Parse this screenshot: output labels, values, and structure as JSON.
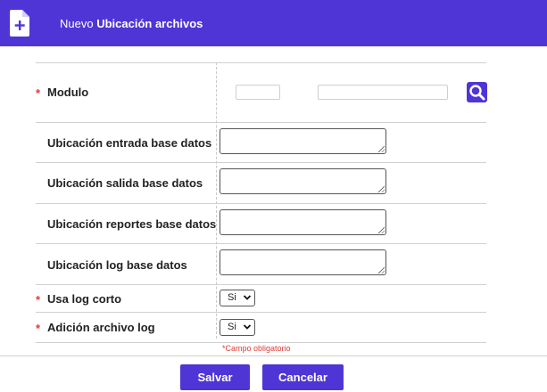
{
  "header": {
    "prefix": "Nuevo",
    "title": "Ubicación archivos",
    "icon": "file-add-icon"
  },
  "form": {
    "modulo": {
      "label": "Modulo",
      "required": true,
      "code_value": "",
      "name_value": "",
      "search_icon": "search-icon"
    },
    "fields": [
      {
        "label": "Ubicación entrada base datos",
        "value": ""
      },
      {
        "label": "Ubicación salida base datos",
        "value": ""
      },
      {
        "label": "Ubicación reportes base datos",
        "value": ""
      },
      {
        "label": "Ubicación log base datos",
        "value": ""
      }
    ],
    "usa_log_corto": {
      "label": "Usa log corto",
      "required": true,
      "value": "Si"
    },
    "adicion_archivo_log": {
      "label": "Adición archivo log",
      "required": true,
      "value": "Si"
    },
    "required_marker": "*",
    "required_note": "*Campo obligatorio"
  },
  "actions": {
    "save_label": "Salvar",
    "cancel_label": "Cancelar"
  },
  "colors": {
    "accent": "#4f35d6",
    "required": "#e53935"
  }
}
